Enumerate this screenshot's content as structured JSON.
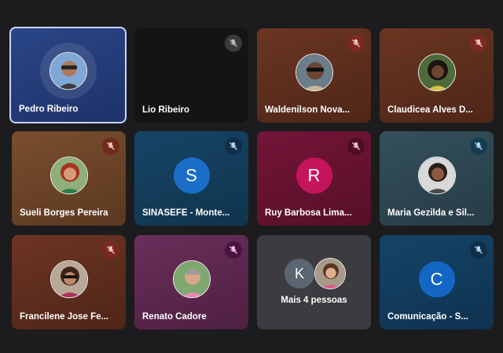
{
  "participants": [
    {
      "name": "Pedro Ribeiro",
      "active": true,
      "muted": false,
      "avatar": "photo",
      "bg": "#243a7a"
    },
    {
      "name": "Lio Ribeiro",
      "muted": true,
      "avatar": "none",
      "bg": "#141414"
    },
    {
      "name": "Waldenilson Nova...",
      "muted": true,
      "avatar": "photo",
      "bg": "#5a2d1e"
    },
    {
      "name": "Claudicea Alves D...",
      "muted": true,
      "avatar": "photo",
      "bg": "#5a2d1e"
    },
    {
      "name": "Sueli Borges Pereira",
      "muted": true,
      "avatar": "photo",
      "bg": "#6b4228"
    },
    {
      "name": "SINASEFE - Monte...",
      "muted": true,
      "avatar": "letter",
      "letter": "S",
      "letter_bg": "#1a6ec7",
      "bg": "#143f5e"
    },
    {
      "name": "Ruy Barbosa Lima...",
      "muted": true,
      "avatar": "letter",
      "letter": "R",
      "letter_bg": "#c4155c",
      "bg": "#6a1232"
    },
    {
      "name": "Maria Gezilda e Sil...",
      "muted": true,
      "avatar": "photo",
      "bg": "#2d4650"
    },
    {
      "name": "Francilene Jose Fe...",
      "muted": true,
      "avatar": "photo",
      "bg": "#5a2a1e"
    },
    {
      "name": "Renato Cadore",
      "muted": true,
      "avatar": "photo",
      "bg": "#5e2750"
    },
    {
      "name": "Comunicação - S...",
      "muted": true,
      "avatar": "letter",
      "letter": "C",
      "letter_bg": "#1366c4",
      "bg": "#133e60"
    }
  ],
  "more_tile": {
    "label": "Mais 4 pessoas",
    "letter": "K",
    "bg": "#3c3c40"
  },
  "icons": {
    "mic_off": "mic-off-icon"
  }
}
